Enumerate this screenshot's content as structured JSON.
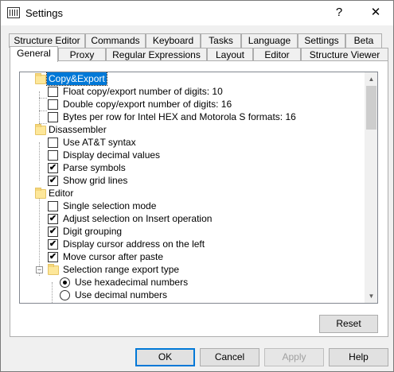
{
  "window": {
    "title": "Settings",
    "help_label": "?",
    "close_label": "✕"
  },
  "tabs_row1": [
    "Structure Editor",
    "Commands",
    "Keyboard",
    "Tasks",
    "Language",
    "Settings",
    "Beta"
  ],
  "tabs_row2": [
    "General",
    "Proxy",
    "Regular Expressions",
    "Layout",
    "Editor",
    "Structure Viewer"
  ],
  "active_tab": "General",
  "tree": {
    "groups": {
      "copy_export": "Copy&Export",
      "disassembler": "Disassembler",
      "editor": "Editor"
    },
    "items": {
      "float_digits": "Float copy/export number of digits: 10",
      "double_digits": "Double copy/export number of digits: 16",
      "bytes_per_row": "Bytes per row for Intel HEX and Motorola S formats: 16",
      "att_syntax": "Use AT&T syntax",
      "display_decimal": "Display decimal values",
      "parse_symbols": "Parse symbols",
      "show_grid": "Show grid lines",
      "single_selection": "Single selection mode",
      "adjust_selection": "Adjust selection on Insert operation",
      "digit_grouping": "Digit grouping",
      "display_cursor_address": "Display cursor address on the left",
      "move_cursor": "Move cursor after paste",
      "selection_range": "Selection range export type",
      "use_hex": "Use hexadecimal numbers",
      "use_decimal": "Use decimal numbers"
    },
    "checked": {
      "float_digits": false,
      "double_digits": false,
      "bytes_per_row": false,
      "att_syntax": false,
      "display_decimal": false,
      "parse_symbols": true,
      "show_grid": true,
      "single_selection": false,
      "adjust_selection": true,
      "digit_grouping": true,
      "display_cursor_address": true,
      "move_cursor": true,
      "use_hex": true,
      "use_decimal": false
    },
    "check_glyph": "✔",
    "collapse_glyph": "−"
  },
  "buttons": {
    "reset": "Reset",
    "ok": "OK",
    "cancel": "Cancel",
    "apply": "Apply",
    "help": "Help"
  },
  "colors": {
    "selection": "#0078d7",
    "folder": "#fde79a"
  }
}
